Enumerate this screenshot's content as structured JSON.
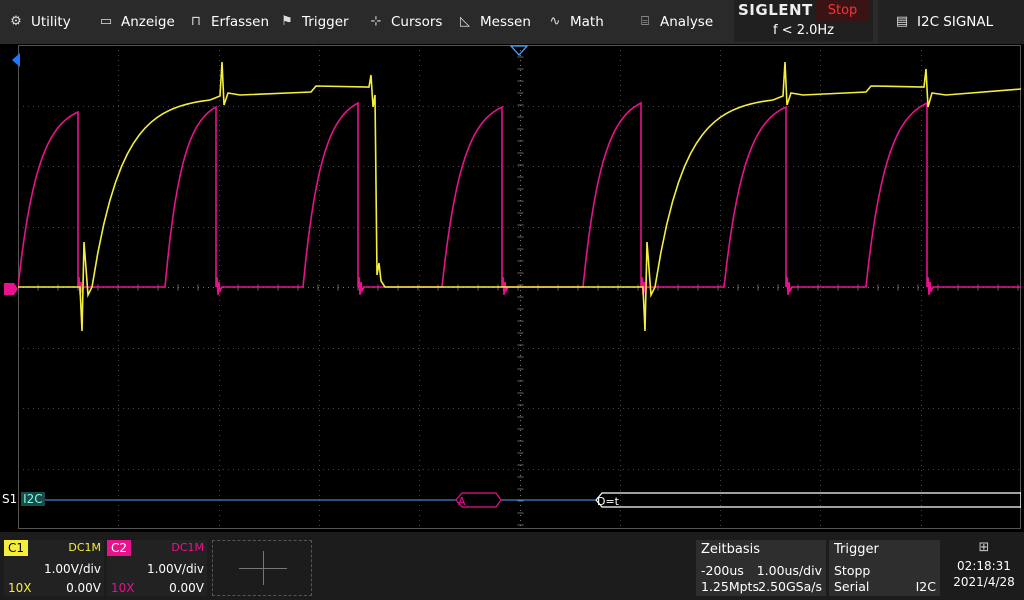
{
  "menu": {
    "items": [
      {
        "label": "Utility",
        "icon": "gear-icon"
      },
      {
        "label": "Anzeige",
        "icon": "monitor-icon"
      },
      {
        "label": "Erfassen",
        "icon": "acquire-icon"
      },
      {
        "label": "Trigger",
        "icon": "flag-icon"
      },
      {
        "label": "Cursors",
        "icon": "crosshair-icon"
      },
      {
        "label": "Messen",
        "icon": "measure-icon"
      },
      {
        "label": "Math",
        "icon": "math-icon"
      },
      {
        "label": "Analyse",
        "icon": "analyse-icon"
      }
    ],
    "brand": "SIGLENT",
    "status": "Stop",
    "frequency": "f < 2.0Hz",
    "decode_menu": "I2C SIGNAL"
  },
  "decode": {
    "label": "S1",
    "protocol": "I2C",
    "frame_a": "A",
    "frame_data": "D=t"
  },
  "channels": {
    "c1": {
      "name": "C1",
      "coupling": "DC1M",
      "vdiv": "1.00V/div",
      "probe": "10X",
      "offset": "0.00V",
      "color": "#f4ef3c"
    },
    "c2": {
      "name": "C2",
      "coupling": "DC1M",
      "vdiv": "1.00V/div",
      "probe": "10X",
      "offset": "0.00V",
      "color": "#e8128c"
    }
  },
  "timebase": {
    "title": "Zeitbasis",
    "delay": "-200us",
    "tdiv": "1.00us/div",
    "points": "1.25Mpts",
    "rate": "2.50GSa/s"
  },
  "trigger": {
    "title": "Trigger",
    "mode": "Stopp",
    "type": "Serial",
    "source": "I2C"
  },
  "clock": {
    "time": "02:18:31",
    "date": "2021/4/28"
  },
  "colors": {
    "background": "#000000",
    "grid": "#3a3a3a",
    "decode_line": "#4aa3ff",
    "frame_a": "#e8128c",
    "frame_data": "#ffffff"
  }
}
